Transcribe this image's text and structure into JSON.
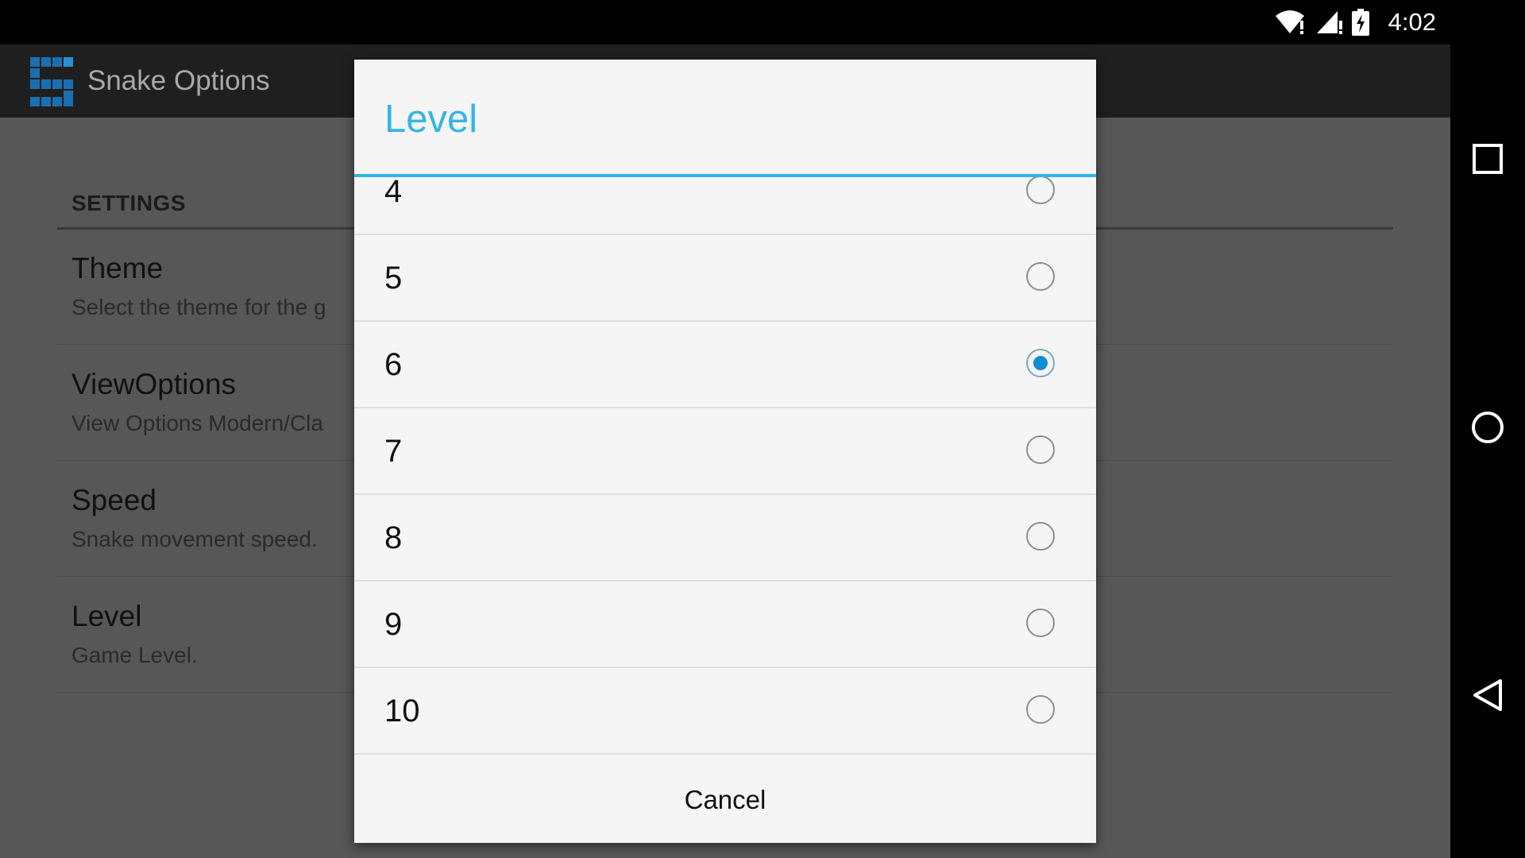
{
  "status_bar": {
    "time": "4:02",
    "icons": [
      "wifi-icon",
      "cell-signal-icon",
      "battery-charging-icon"
    ]
  },
  "action_bar": {
    "title": "Snake Options",
    "icon": "snake-app-icon"
  },
  "settings": {
    "section_header": "SETTINGS",
    "items": [
      {
        "title": "Theme",
        "summary": "Select the theme for the g"
      },
      {
        "title": "ViewOptions",
        "summary": "View Options Modern/Cla"
      },
      {
        "title": "Speed",
        "summary": "Snake movement speed."
      },
      {
        "title": "Level",
        "summary": "Game Level."
      }
    ]
  },
  "dialog": {
    "title": "Level",
    "options": [
      {
        "label": "4",
        "checked": false
      },
      {
        "label": "5",
        "checked": false
      },
      {
        "label": "6",
        "checked": true
      },
      {
        "label": "7",
        "checked": false
      },
      {
        "label": "8",
        "checked": false
      },
      {
        "label": "9",
        "checked": false
      },
      {
        "label": "10",
        "checked": false
      }
    ],
    "cancel_label": "Cancel"
  },
  "nav_bar": {
    "icons": [
      "recents-icon",
      "home-icon",
      "back-icon"
    ]
  },
  "colors": {
    "accent": "#33b5e5",
    "radio_checked": "#0f8fd3"
  }
}
